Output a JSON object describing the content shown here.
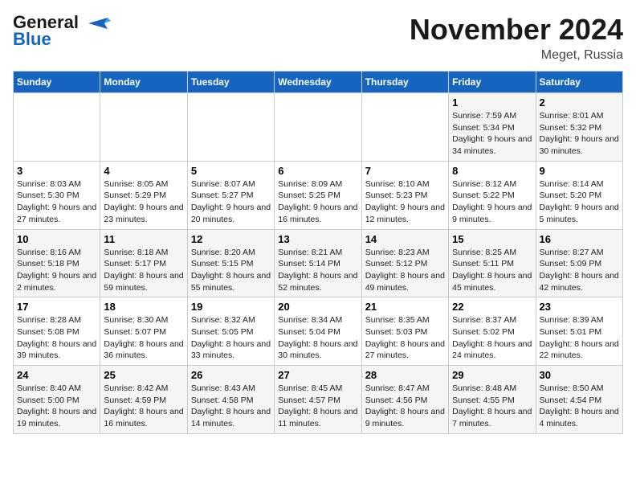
{
  "logo": {
    "line1": "General",
    "line2": "Blue"
  },
  "title": "November 2024",
  "location": "Meget, Russia",
  "weekdays": [
    "Sunday",
    "Monday",
    "Tuesday",
    "Wednesday",
    "Thursday",
    "Friday",
    "Saturday"
  ],
  "weeks": [
    [
      {
        "day": "",
        "data": ""
      },
      {
        "day": "",
        "data": ""
      },
      {
        "day": "",
        "data": ""
      },
      {
        "day": "",
        "data": ""
      },
      {
        "day": "",
        "data": ""
      },
      {
        "day": "1",
        "data": "Sunrise: 7:59 AM\nSunset: 5:34 PM\nDaylight: 9 hours and 34 minutes."
      },
      {
        "day": "2",
        "data": "Sunrise: 8:01 AM\nSunset: 5:32 PM\nDaylight: 9 hours and 30 minutes."
      }
    ],
    [
      {
        "day": "3",
        "data": "Sunrise: 8:03 AM\nSunset: 5:30 PM\nDaylight: 9 hours and 27 minutes."
      },
      {
        "day": "4",
        "data": "Sunrise: 8:05 AM\nSunset: 5:29 PM\nDaylight: 9 hours and 23 minutes."
      },
      {
        "day": "5",
        "data": "Sunrise: 8:07 AM\nSunset: 5:27 PM\nDaylight: 9 hours and 20 minutes."
      },
      {
        "day": "6",
        "data": "Sunrise: 8:09 AM\nSunset: 5:25 PM\nDaylight: 9 hours and 16 minutes."
      },
      {
        "day": "7",
        "data": "Sunrise: 8:10 AM\nSunset: 5:23 PM\nDaylight: 9 hours and 12 minutes."
      },
      {
        "day": "8",
        "data": "Sunrise: 8:12 AM\nSunset: 5:22 PM\nDaylight: 9 hours and 9 minutes."
      },
      {
        "day": "9",
        "data": "Sunrise: 8:14 AM\nSunset: 5:20 PM\nDaylight: 9 hours and 5 minutes."
      }
    ],
    [
      {
        "day": "10",
        "data": "Sunrise: 8:16 AM\nSunset: 5:18 PM\nDaylight: 9 hours and 2 minutes."
      },
      {
        "day": "11",
        "data": "Sunrise: 8:18 AM\nSunset: 5:17 PM\nDaylight: 8 hours and 59 minutes."
      },
      {
        "day": "12",
        "data": "Sunrise: 8:20 AM\nSunset: 5:15 PM\nDaylight: 8 hours and 55 minutes."
      },
      {
        "day": "13",
        "data": "Sunrise: 8:21 AM\nSunset: 5:14 PM\nDaylight: 8 hours and 52 minutes."
      },
      {
        "day": "14",
        "data": "Sunrise: 8:23 AM\nSunset: 5:12 PM\nDaylight: 8 hours and 49 minutes."
      },
      {
        "day": "15",
        "data": "Sunrise: 8:25 AM\nSunset: 5:11 PM\nDaylight: 8 hours and 45 minutes."
      },
      {
        "day": "16",
        "data": "Sunrise: 8:27 AM\nSunset: 5:09 PM\nDaylight: 8 hours and 42 minutes."
      }
    ],
    [
      {
        "day": "17",
        "data": "Sunrise: 8:28 AM\nSunset: 5:08 PM\nDaylight: 8 hours and 39 minutes."
      },
      {
        "day": "18",
        "data": "Sunrise: 8:30 AM\nSunset: 5:07 PM\nDaylight: 8 hours and 36 minutes."
      },
      {
        "day": "19",
        "data": "Sunrise: 8:32 AM\nSunset: 5:05 PM\nDaylight: 8 hours and 33 minutes."
      },
      {
        "day": "20",
        "data": "Sunrise: 8:34 AM\nSunset: 5:04 PM\nDaylight: 8 hours and 30 minutes."
      },
      {
        "day": "21",
        "data": "Sunrise: 8:35 AM\nSunset: 5:03 PM\nDaylight: 8 hours and 27 minutes."
      },
      {
        "day": "22",
        "data": "Sunrise: 8:37 AM\nSunset: 5:02 PM\nDaylight: 8 hours and 24 minutes."
      },
      {
        "day": "23",
        "data": "Sunrise: 8:39 AM\nSunset: 5:01 PM\nDaylight: 8 hours and 22 minutes."
      }
    ],
    [
      {
        "day": "24",
        "data": "Sunrise: 8:40 AM\nSunset: 5:00 PM\nDaylight: 8 hours and 19 minutes."
      },
      {
        "day": "25",
        "data": "Sunrise: 8:42 AM\nSunset: 4:59 PM\nDaylight: 8 hours and 16 minutes."
      },
      {
        "day": "26",
        "data": "Sunrise: 8:43 AM\nSunset: 4:58 PM\nDaylight: 8 hours and 14 minutes."
      },
      {
        "day": "27",
        "data": "Sunrise: 8:45 AM\nSunset: 4:57 PM\nDaylight: 8 hours and 11 minutes."
      },
      {
        "day": "28",
        "data": "Sunrise: 8:47 AM\nSunset: 4:56 PM\nDaylight: 8 hours and 9 minutes."
      },
      {
        "day": "29",
        "data": "Sunrise: 8:48 AM\nSunset: 4:55 PM\nDaylight: 8 hours and 7 minutes."
      },
      {
        "day": "30",
        "data": "Sunrise: 8:50 AM\nSunset: 4:54 PM\nDaylight: 8 hours and 4 minutes."
      }
    ]
  ]
}
